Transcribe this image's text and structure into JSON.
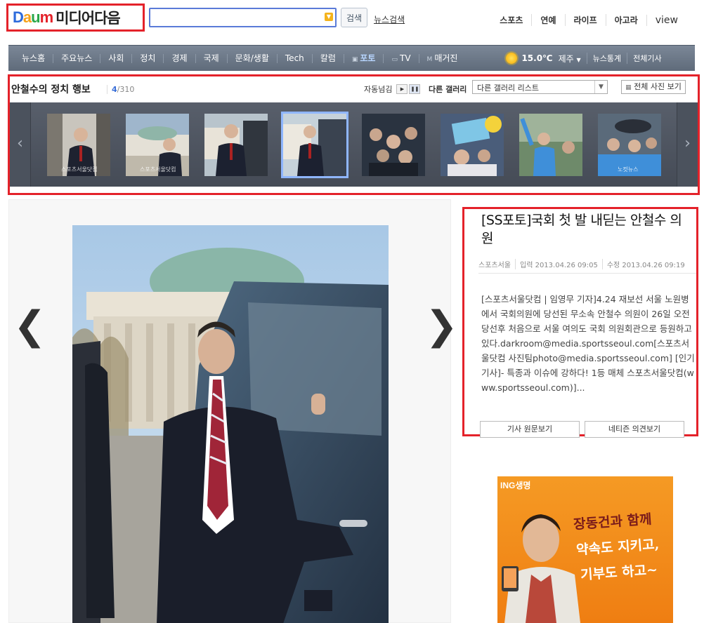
{
  "header": {
    "logo_daum": [
      "D",
      "a",
      "u",
      "m"
    ],
    "logo_text": "미디어다음",
    "search_button": "검색",
    "news_search": "뉴스검색",
    "top_links": [
      "스포츠",
      "연예",
      "라이프",
      "아고라",
      "view"
    ]
  },
  "gnb": {
    "items": [
      "뉴스홈",
      "주요뉴스",
      "사회",
      "정치",
      "경제",
      "국제",
      "문화/생활",
      "Tech",
      "칼럼"
    ],
    "photo": "포토",
    "tv": "TV",
    "magazine": "매거진",
    "temperature": "15.0℃",
    "region": "제주",
    "right_links": [
      "뉴스통계",
      "전체기사"
    ]
  },
  "gallery": {
    "title": "안철수의 정치 행보",
    "current": "4",
    "total": "/310",
    "autoplay_label": "자동넘김",
    "other_gallery_label": "다른 갤러리",
    "other_gallery_select": "다른 갤러리 리스트",
    "all_photos": "전체 사진 보기",
    "thumb_caption": "스포츠서울닷컴",
    "thumb_caption_alt": "노컷뉴스"
  },
  "article": {
    "title": "[SS포토]국회 첫 발 내딛는 안철수 의원",
    "source": "스포츠서울",
    "input_time": "입력 2013.04.26 09:05",
    "edit_time": "수정 2013.04.26 09:19",
    "body": "[스포츠서울닷컴 | 임영무 기자]4.24 재보선 서울 노원병에서 국회의원에 당선된 무소속 안철수 의원이 26일 오전 당선후 처음으로 서울 여의도 국회 의원회관으로 등원하고 있다.darkroom@media.sportsseoul.com[스포츠서울닷컴 사진팀photo@media.sportsseoul.com] [인기기사]- 특종과 이슈에 강하다! 1등 매체 스포츠서울닷컴(www.sportsseoul.com)]...",
    "original_button": "기사 원문보기",
    "opinion_button": "네티즌 의견보기"
  },
  "ad": {
    "brand": "ING생명",
    "line1": "장동건과 함께",
    "line2": "약속도 지키고,",
    "line3": "기부도 하고~"
  },
  "colors": {
    "highlight_border": "#e4222a",
    "gnb_bg": "#6b7787",
    "accent_blue": "#3a6fd8"
  }
}
